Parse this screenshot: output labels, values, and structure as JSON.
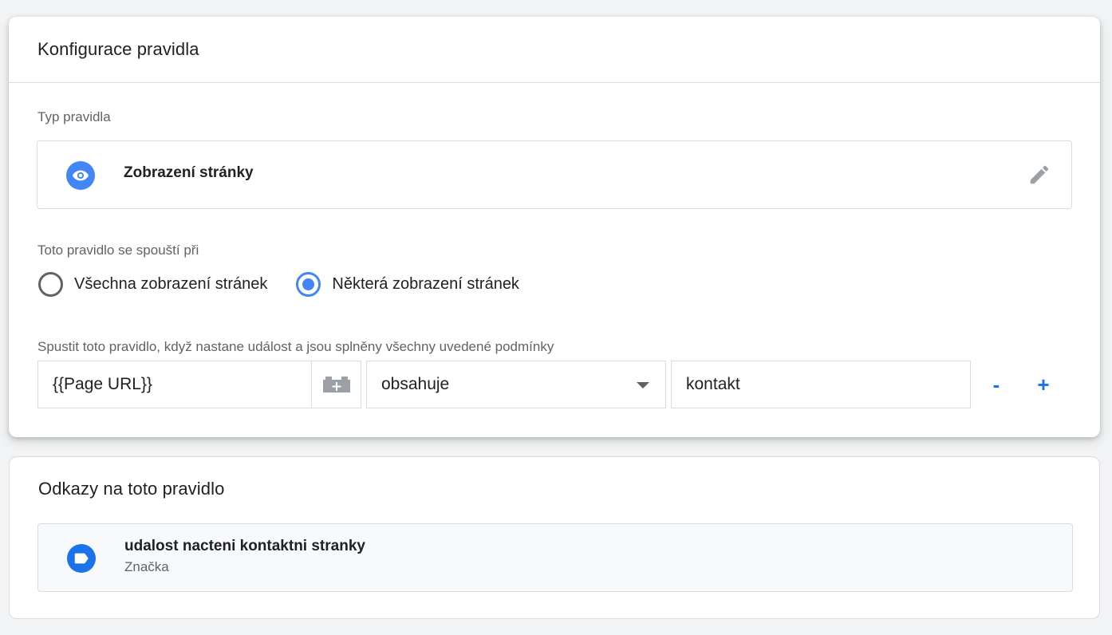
{
  "config_card": {
    "title": "Konfigurace pravidla",
    "type_label": "Typ pravidla",
    "type": {
      "icon": "eye-icon",
      "name": "Zobrazení stránky",
      "edit_icon": "pencil-icon"
    },
    "fires_on_label": "Toto pravidlo se spouští při",
    "fires_on_options": [
      {
        "label": "Všechna zobrazení stránek",
        "checked": false
      },
      {
        "label": "Některá zobrazení stránek",
        "checked": true
      }
    ],
    "condition_label": "Spustit toto pravidlo, když nastane událost a jsou splněny všechny uvedené podmínky",
    "condition": {
      "variable": "{{Page URL}}",
      "variable_picker_icon": "lego-brick-add-icon",
      "operator": "obsahuje",
      "value": "kontakt",
      "remove_label": "-",
      "add_label": "+"
    }
  },
  "refs_card": {
    "title": "Odkazy na toto pravidlo",
    "items": [
      {
        "icon": "tag-icon",
        "name": "udalost nacteni kontaktni stranky",
        "type": "Značka"
      }
    ]
  },
  "colors": {
    "accent": "#4285f4",
    "link": "#1a73e8",
    "border": "#dadce0",
    "background": "#f1f3f4"
  }
}
